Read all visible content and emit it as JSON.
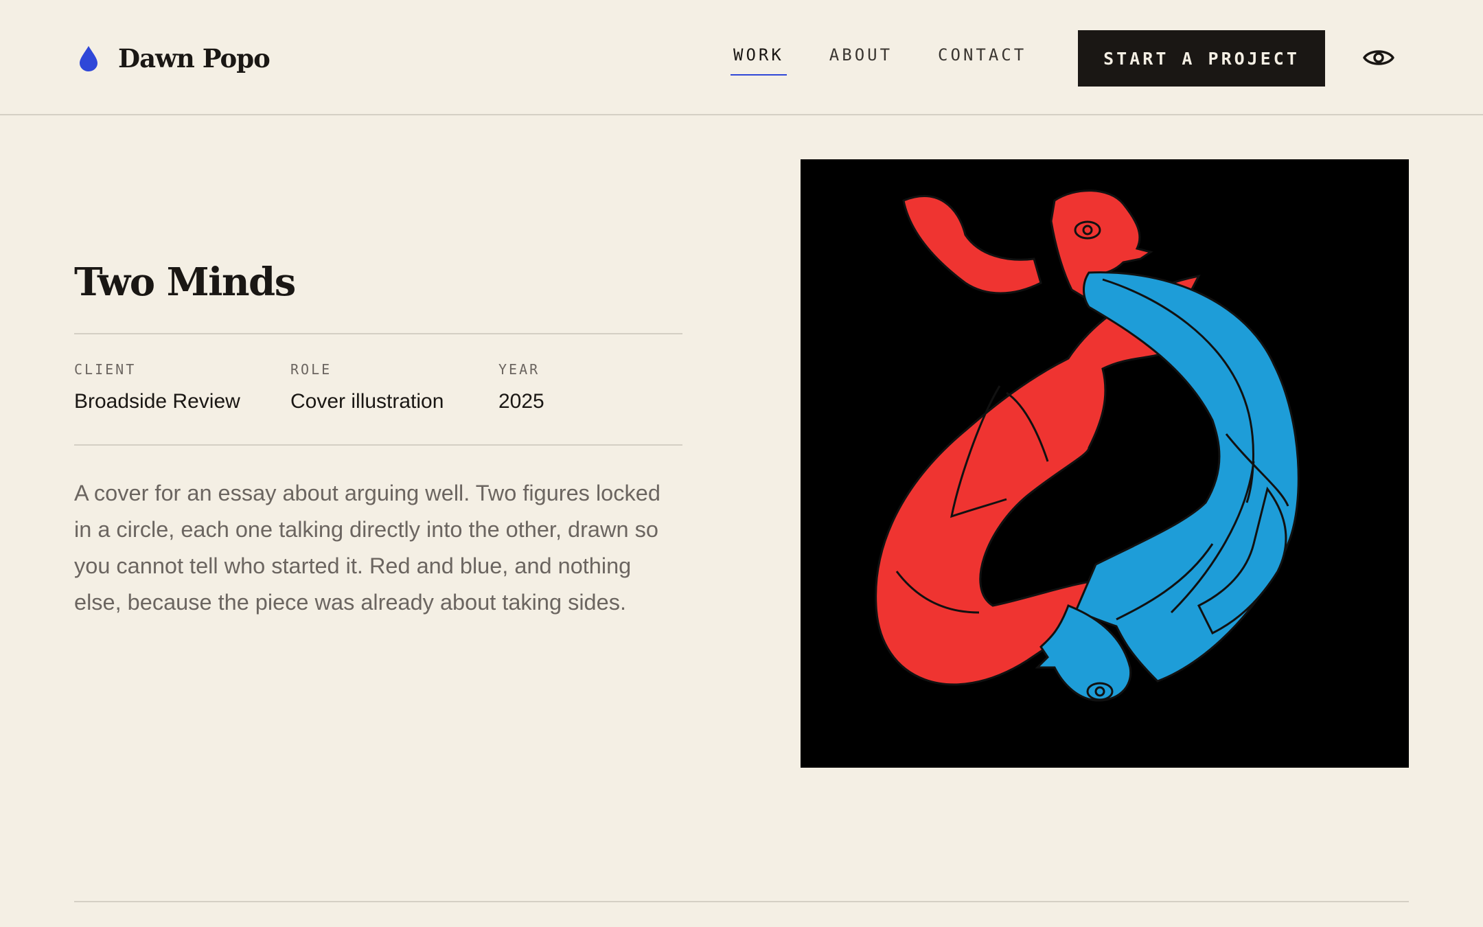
{
  "brand": {
    "name": "Dawn Popo",
    "icon": "drop-icon",
    "color": "#2f47d8"
  },
  "nav": {
    "items": [
      {
        "label": "WORK",
        "active": true
      },
      {
        "label": "ABOUT",
        "active": false
      },
      {
        "label": "CONTACT",
        "active": false
      }
    ],
    "cta_label": "START A PROJECT",
    "eye_icon": "eye-icon"
  },
  "project": {
    "title": "Two Minds",
    "meta": [
      {
        "label": "CLIENT",
        "value": "Broadside Review"
      },
      {
        "label": "ROLE",
        "value": "Cover illustration"
      },
      {
        "label": "YEAR",
        "value": "2025"
      }
    ],
    "description": "A cover for an essay about arguing well. Two figures locked in a circle, each one talking directly into the other, drawn so you cannot tell who started it. Red and blue, and nothing else, because the piece was already about taking sides."
  },
  "colors": {
    "background": "#f4efe4",
    "accent": "#2f47d8",
    "ink": "#1a1714",
    "muted": "#6b6560",
    "art_red": "#ef3431",
    "art_blue": "#1e9dd8"
  }
}
